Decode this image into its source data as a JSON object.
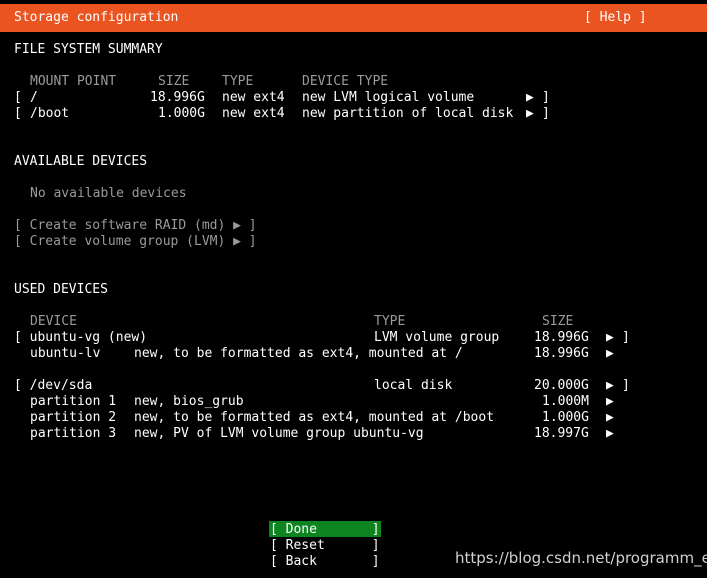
{
  "window": {
    "title": "Storage configuration",
    "help": "[ Help ]"
  },
  "fs_summary": {
    "heading": "FILE SYSTEM SUMMARY",
    "headers": {
      "mount": "MOUNT POINT",
      "size": "SIZE",
      "type": "TYPE",
      "device_type": "DEVICE TYPE"
    },
    "rows": [
      {
        "open": "[",
        "mount": "/",
        "size": "18.996G",
        "type": "new ext4",
        "device_type": "new LVM logical volume",
        "arrow": "▶",
        "close": "]"
      },
      {
        "open": "[",
        "mount": "/boot",
        "size": "1.000G",
        "type": "new ext4",
        "device_type": "new partition of local disk",
        "arrow": "▶",
        "close": "]"
      }
    ]
  },
  "available": {
    "heading": "AVAILABLE DEVICES",
    "empty": "No available devices",
    "actions": [
      "[ Create software RAID (md) ▶ ]",
      "[ Create volume group (LVM) ▶ ]"
    ]
  },
  "used": {
    "heading": "USED DEVICES",
    "headers": {
      "device": "DEVICE",
      "type": "TYPE",
      "size": "SIZE"
    },
    "groups": [
      {
        "name": "[ ubuntu-vg (new)",
        "type": "LVM volume group",
        "size": "18.996G",
        "arrow": "▶",
        "close": "]",
        "children": [
          {
            "name": "ubuntu-lv",
            "desc": "new, to be formatted as ext4, mounted at /",
            "size": "18.996G",
            "arrow": "▶"
          }
        ]
      },
      {
        "name": "[ /dev/sda",
        "type": "local disk",
        "size": "20.000G",
        "arrow": "▶",
        "close": "]",
        "children": [
          {
            "name": "partition 1",
            "desc": "new, bios_grub",
            "size": "1.000M",
            "arrow": "▶"
          },
          {
            "name": "partition 2",
            "desc": "new, to be formatted as ext4, mounted at /boot",
            "size": "1.000G",
            "arrow": "▶"
          },
          {
            "name": "partition 3",
            "desc": "new, PV of LVM volume group ubuntu-vg",
            "size": "18.997G",
            "arrow": "▶"
          }
        ]
      }
    ]
  },
  "buttons": {
    "done": "[ Done       ]",
    "reset": "[ Reset      ]",
    "back": "[ Back       ]"
  },
  "watermark": "https://blog.csdn.net/programm_er",
  "colors": {
    "title_bar": "#e95420",
    "done_button": "#0e8420",
    "background": "#000000"
  }
}
